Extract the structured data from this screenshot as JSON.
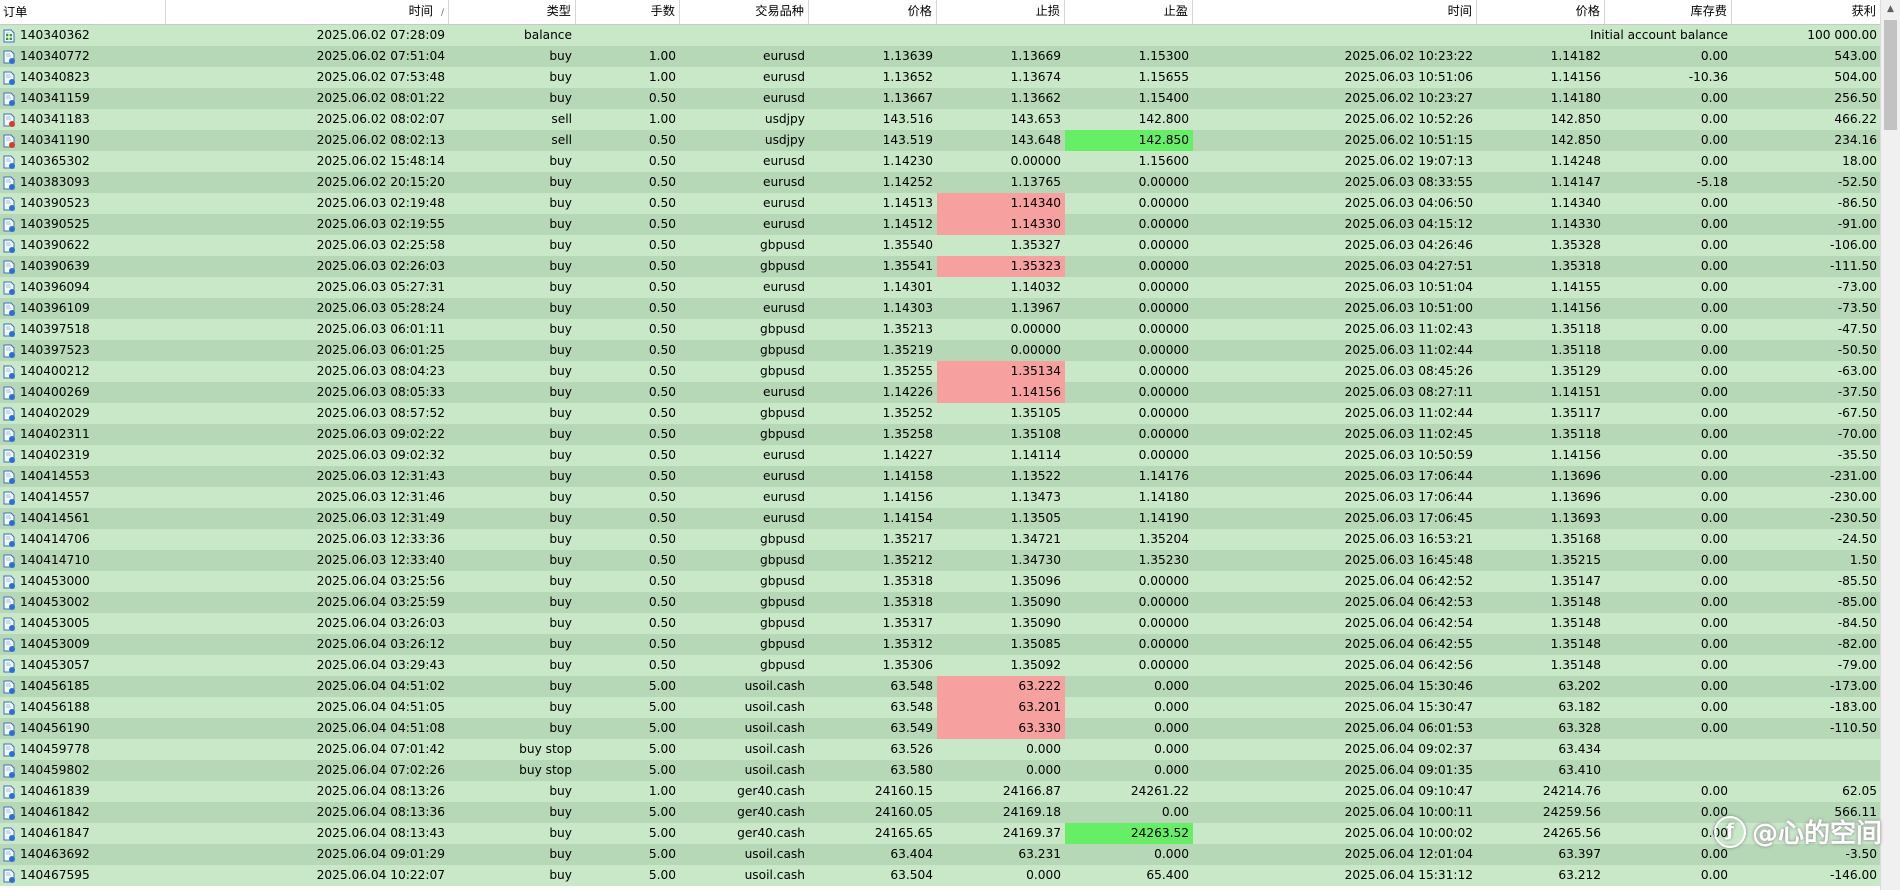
{
  "headers": [
    "订单",
    "时间",
    "类型",
    "手数",
    "交易品种",
    "价格",
    "止损",
    "止盈",
    "时间",
    "价格",
    "库存费",
    "获利"
  ],
  "sort_indicator": "/",
  "balance_row": {
    "order": "140340362",
    "time": "2025.06.02 07:28:09",
    "type": "balance",
    "comment": "Initial account balance",
    "profit": "100 000.00"
  },
  "rows": [
    [
      "140340772",
      "2025.06.02 07:51:04",
      "buy",
      "1.00",
      "eurusd",
      "1.13639",
      "1.13669",
      "1.15300",
      "2025.06.02 10:23:22",
      "1.14182",
      "0.00",
      "543.00"
    ],
    [
      "140340823",
      "2025.06.02 07:53:48",
      "buy",
      "1.00",
      "eurusd",
      "1.13652",
      "1.13674",
      "1.15655",
      "2025.06.03 10:51:06",
      "1.14156",
      "-10.36",
      "504.00"
    ],
    [
      "140341159",
      "2025.06.02 08:01:22",
      "buy",
      "0.50",
      "eurusd",
      "1.13667",
      "1.13662",
      "1.15400",
      "2025.06.02 10:23:27",
      "1.14180",
      "0.00",
      "256.50"
    ],
    [
      "140341183",
      "2025.06.02 08:02:07",
      "sell",
      "1.00",
      "usdjpy",
      "143.516",
      "143.653",
      "142.800",
      "2025.06.02 10:52:26",
      "142.850",
      "0.00",
      "466.22"
    ],
    [
      "140341190",
      "2025.06.02 08:02:13",
      "sell",
      "0.50",
      "usdjpy",
      "143.519",
      "143.648",
      "142.850",
      "2025.06.02 10:51:15",
      "142.850",
      "0.00",
      "234.16"
    ],
    [
      "140365302",
      "2025.06.02 15:48:14",
      "buy",
      "0.50",
      "eurusd",
      "1.14230",
      "0.00000",
      "1.15600",
      "2025.06.02 19:07:13",
      "1.14248",
      "0.00",
      "18.00"
    ],
    [
      "140383093",
      "2025.06.02 20:15:20",
      "buy",
      "0.50",
      "eurusd",
      "1.14252",
      "1.13765",
      "0.00000",
      "2025.06.03 08:33:55",
      "1.14147",
      "-5.18",
      "-52.50"
    ],
    [
      "140390523",
      "2025.06.03 02:19:48",
      "buy",
      "0.50",
      "eurusd",
      "1.14513",
      "1.14340",
      "0.00000",
      "2025.06.03 04:06:50",
      "1.14340",
      "0.00",
      "-86.50"
    ],
    [
      "140390525",
      "2025.06.03 02:19:55",
      "buy",
      "0.50",
      "eurusd",
      "1.14512",
      "1.14330",
      "0.00000",
      "2025.06.03 04:15:12",
      "1.14330",
      "0.00",
      "-91.00"
    ],
    [
      "140390622",
      "2025.06.03 02:25:58",
      "buy",
      "0.50",
      "gbpusd",
      "1.35540",
      "1.35327",
      "0.00000",
      "2025.06.03 04:26:46",
      "1.35328",
      "0.00",
      "-106.00"
    ],
    [
      "140390639",
      "2025.06.03 02:26:03",
      "buy",
      "0.50",
      "gbpusd",
      "1.35541",
      "1.35323",
      "0.00000",
      "2025.06.03 04:27:51",
      "1.35318",
      "0.00",
      "-111.50"
    ],
    [
      "140396094",
      "2025.06.03 05:27:31",
      "buy",
      "0.50",
      "eurusd",
      "1.14301",
      "1.14032",
      "0.00000",
      "2025.06.03 10:51:04",
      "1.14155",
      "0.00",
      "-73.00"
    ],
    [
      "140396109",
      "2025.06.03 05:28:24",
      "buy",
      "0.50",
      "eurusd",
      "1.14303",
      "1.13967",
      "0.00000",
      "2025.06.03 10:51:00",
      "1.14156",
      "0.00",
      "-73.50"
    ],
    [
      "140397518",
      "2025.06.03 06:01:11",
      "buy",
      "0.50",
      "gbpusd",
      "1.35213",
      "0.00000",
      "0.00000",
      "2025.06.03 11:02:43",
      "1.35118",
      "0.00",
      "-47.50"
    ],
    [
      "140397523",
      "2025.06.03 06:01:25",
      "buy",
      "0.50",
      "gbpusd",
      "1.35219",
      "0.00000",
      "0.00000",
      "2025.06.03 11:02:44",
      "1.35118",
      "0.00",
      "-50.50"
    ],
    [
      "140400212",
      "2025.06.03 08:04:23",
      "buy",
      "0.50",
      "gbpusd",
      "1.35255",
      "1.35134",
      "0.00000",
      "2025.06.03 08:45:26",
      "1.35129",
      "0.00",
      "-63.00"
    ],
    [
      "140400269",
      "2025.06.03 08:05:33",
      "buy",
      "0.50",
      "eurusd",
      "1.14226",
      "1.14156",
      "0.00000",
      "2025.06.03 08:27:11",
      "1.14151",
      "0.00",
      "-37.50"
    ],
    [
      "140402029",
      "2025.06.03 08:57:52",
      "buy",
      "0.50",
      "gbpusd",
      "1.35252",
      "1.35105",
      "0.00000",
      "2025.06.03 11:02:44",
      "1.35117",
      "0.00",
      "-67.50"
    ],
    [
      "140402311",
      "2025.06.03 09:02:22",
      "buy",
      "0.50",
      "gbpusd",
      "1.35258",
      "1.35108",
      "0.00000",
      "2025.06.03 11:02:45",
      "1.35118",
      "0.00",
      "-70.00"
    ],
    [
      "140402319",
      "2025.06.03 09:02:32",
      "buy",
      "0.50",
      "eurusd",
      "1.14227",
      "1.14114",
      "0.00000",
      "2025.06.03 10:50:59",
      "1.14156",
      "0.00",
      "-35.50"
    ],
    [
      "140414553",
      "2025.06.03 12:31:43",
      "buy",
      "0.50",
      "eurusd",
      "1.14158",
      "1.13522",
      "1.14176",
      "2025.06.03 17:06:44",
      "1.13696",
      "0.00",
      "-231.00"
    ],
    [
      "140414557",
      "2025.06.03 12:31:46",
      "buy",
      "0.50",
      "eurusd",
      "1.14156",
      "1.13473",
      "1.14180",
      "2025.06.03 17:06:44",
      "1.13696",
      "0.00",
      "-230.00"
    ],
    [
      "140414561",
      "2025.06.03 12:31:49",
      "buy",
      "0.50",
      "eurusd",
      "1.14154",
      "1.13505",
      "1.14190",
      "2025.06.03 17:06:45",
      "1.13693",
      "0.00",
      "-230.50"
    ],
    [
      "140414706",
      "2025.06.03 12:33:36",
      "buy",
      "0.50",
      "gbpusd",
      "1.35217",
      "1.34721",
      "1.35204",
      "2025.06.03 16:53:21",
      "1.35168",
      "0.00",
      "-24.50"
    ],
    [
      "140414710",
      "2025.06.03 12:33:40",
      "buy",
      "0.50",
      "gbpusd",
      "1.35212",
      "1.34730",
      "1.35230",
      "2025.06.03 16:45:48",
      "1.35215",
      "0.00",
      "1.50"
    ],
    [
      "140453000",
      "2025.06.04 03:25:56",
      "buy",
      "0.50",
      "gbpusd",
      "1.35318",
      "1.35096",
      "0.00000",
      "2025.06.04 06:42:52",
      "1.35147",
      "0.00",
      "-85.50"
    ],
    [
      "140453002",
      "2025.06.04 03:25:59",
      "buy",
      "0.50",
      "gbpusd",
      "1.35318",
      "1.35090",
      "0.00000",
      "2025.06.04 06:42:53",
      "1.35148",
      "0.00",
      "-85.00"
    ],
    [
      "140453005",
      "2025.06.04 03:26:03",
      "buy",
      "0.50",
      "gbpusd",
      "1.35317",
      "1.35090",
      "0.00000",
      "2025.06.04 06:42:54",
      "1.35148",
      "0.00",
      "-84.50"
    ],
    [
      "140453009",
      "2025.06.04 03:26:12",
      "buy",
      "0.50",
      "gbpusd",
      "1.35312",
      "1.35085",
      "0.00000",
      "2025.06.04 06:42:55",
      "1.35148",
      "0.00",
      "-82.00"
    ],
    [
      "140453057",
      "2025.06.04 03:29:43",
      "buy",
      "0.50",
      "gbpusd",
      "1.35306",
      "1.35092",
      "0.00000",
      "2025.06.04 06:42:56",
      "1.35148",
      "0.00",
      "-79.00"
    ],
    [
      "140456185",
      "2025.06.04 04:51:02",
      "buy",
      "5.00",
      "usoil.cash",
      "63.548",
      "63.222",
      "0.000",
      "2025.06.04 15:30:46",
      "63.202",
      "0.00",
      "-173.00"
    ],
    [
      "140456188",
      "2025.06.04 04:51:05",
      "buy",
      "5.00",
      "usoil.cash",
      "63.548",
      "63.201",
      "0.000",
      "2025.06.04 15:30:47",
      "63.182",
      "0.00",
      "-183.00"
    ],
    [
      "140456190",
      "2025.06.04 04:51:08",
      "buy",
      "5.00",
      "usoil.cash",
      "63.549",
      "63.330",
      "0.000",
      "2025.06.04 06:01:53",
      "63.328",
      "0.00",
      "-110.50"
    ],
    [
      "140459778",
      "2025.06.04 07:01:42",
      "buy stop",
      "5.00",
      "usoil.cash",
      "63.526",
      "0.000",
      "0.000",
      "2025.06.04 09:02:37",
      "63.434",
      "",
      ""
    ],
    [
      "140459802",
      "2025.06.04 07:02:26",
      "buy stop",
      "5.00",
      "usoil.cash",
      "63.580",
      "0.000",
      "0.000",
      "2025.06.04 09:01:35",
      "63.410",
      "",
      ""
    ],
    [
      "140461839",
      "2025.06.04 08:13:26",
      "buy",
      "1.00",
      "ger40.cash",
      "24160.15",
      "24166.87",
      "24261.22",
      "2025.06.04 09:10:47",
      "24214.76",
      "0.00",
      "62.05"
    ],
    [
      "140461842",
      "2025.06.04 08:13:36",
      "buy",
      "5.00",
      "ger40.cash",
      "24160.05",
      "24169.18",
      "0.00",
      "2025.06.04 10:00:11",
      "24259.56",
      "0.00",
      "566.11"
    ],
    [
      "140461847",
      "2025.06.04 08:13:43",
      "buy",
      "5.00",
      "ger40.cash",
      "24165.65",
      "24169.37",
      "24263.52",
      "2025.06.04 10:00:02",
      "24265.56",
      "0.00",
      ""
    ],
    [
      "140463692",
      "2025.06.04 09:01:29",
      "buy",
      "5.00",
      "usoil.cash",
      "63.404",
      "63.231",
      "0.000",
      "2025.06.04 12:01:04",
      "63.397",
      "0.00",
      "-3.50"
    ],
    [
      "140467595",
      "2025.06.04 10:22:07",
      "buy",
      "5.00",
      "usoil.cash",
      "63.504",
      "0.000",
      "65.400",
      "2025.06.04 15:31:12",
      "63.212",
      "0.00",
      "-146.00"
    ]
  ],
  "highlight_colors": {
    "stop_loss_hit": "#f6a0a0",
    "take_profit_hit": "#66ee66",
    "row_odd": "#c8e8c8",
    "row_even": "#b6d8b6"
  },
  "watermark": {
    "text": "@心的空间"
  }
}
